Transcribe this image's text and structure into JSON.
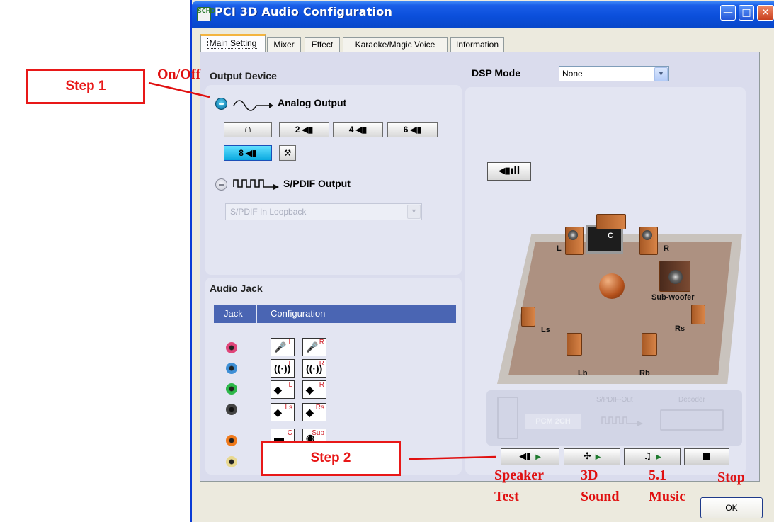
{
  "window": {
    "title": "PCI 3D Audio Configuration",
    "app_icon_text": "SCHD",
    "minimize_glyph": "—",
    "maximize_glyph": "□",
    "close_glyph": "✕"
  },
  "tabs": [
    {
      "label": "Main Setting",
      "active": true
    },
    {
      "label": "Mixer",
      "active": false
    },
    {
      "label": "Effect",
      "active": false
    },
    {
      "label": "Karaoke/Magic Voice",
      "active": false
    },
    {
      "label": "Information",
      "active": false
    }
  ],
  "output_device": {
    "heading": "Output Device",
    "analog_label": "Analog Output",
    "analog_on": true,
    "speaker_buttons": [
      {
        "label": "",
        "icon": "headphone-icon",
        "active": false
      },
      {
        "label": "2",
        "icon": "speaker-icon",
        "active": false
      },
      {
        "label": "4",
        "icon": "speaker-icon",
        "active": false
      },
      {
        "label": "6",
        "icon": "speaker-icon",
        "active": false
      },
      {
        "label": "8",
        "icon": "speaker-icon",
        "active": true
      }
    ],
    "spdif_label": "S/PDIF Output",
    "spdif_on": false,
    "spdif_select_value": "S/PDIF In Loopback"
  },
  "dsp": {
    "label": "DSP Mode",
    "value": "None"
  },
  "audio_jack": {
    "heading": "Audio Jack",
    "columns": [
      "Jack",
      "Configuration"
    ],
    "rows": [
      {
        "color": "#e0457a",
        "configs": [
          "L",
          "R"
        ],
        "icon": "microphone-icon"
      },
      {
        "color": "#3e8fd6",
        "configs": [
          "L",
          "R"
        ],
        "icon": "line-in-icon"
      },
      {
        "color": "#2db84a",
        "configs": [
          "L",
          "R"
        ],
        "icon": "front-speaker-icon"
      },
      {
        "color": "#333333",
        "configs": [
          "Ls",
          "Rs"
        ],
        "icon": "surround-speaker-icon"
      },
      {
        "color": "#f07a1c",
        "configs": [
          "C",
          "Sub"
        ],
        "icon": "center-sub-icon"
      },
      {
        "color": "#e8d890",
        "configs": [],
        "icon": ""
      }
    ]
  },
  "room": {
    "labels": {
      "c": "C",
      "l": "L",
      "r": "R",
      "sub": "Sub-woofer",
      "ls": "Ls",
      "rs": "Rs",
      "lb": "Lb",
      "rb": "Rb"
    }
  },
  "decoder": {
    "spdif_out": "S/PDIF-Out",
    "decoder": "Decoder",
    "pcm": "PCM 2CH"
  },
  "controls": [
    {
      "name": "speaker-test-button",
      "icon": "speaker-icon"
    },
    {
      "name": "3d-sound-button",
      "icon": "3d-sound-icon"
    },
    {
      "name": "music-button",
      "icon": "music-note-icon"
    },
    {
      "name": "stop-button",
      "icon": "stop-icon"
    }
  ],
  "ok_label": "OK",
  "annotations": {
    "step1": "Step 1",
    "step2": "Step 2",
    "onoff": "On/Off",
    "speaker": "Speaker",
    "test": "Test",
    "three_d": "3D",
    "sound": "Sound",
    "five_one": "5.1",
    "music": "Music",
    "stop": "Stop",
    "color": "#e01010"
  }
}
